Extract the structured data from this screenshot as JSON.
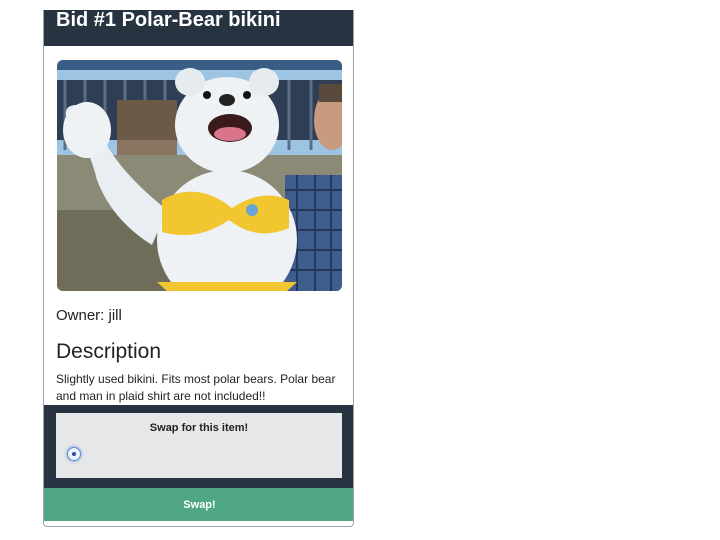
{
  "item": {
    "title": "Bid #1 Polar-Bear bikini",
    "photo_icon": "polar-bear-mascot-photo",
    "owner_label": "Owner: jill",
    "description_heading": "Description",
    "description_text": "Slightly used bikini. Fits most polar bears. Polar bear and man in plaid shirt are not included!!"
  },
  "swap": {
    "prompt": "Swap for this item!",
    "button_label": "Swap!",
    "radio_selected": true
  },
  "colors": {
    "header_bg": "#283341",
    "button_bg": "#4fa683",
    "swap_box_bg": "#e6e7e8"
  }
}
